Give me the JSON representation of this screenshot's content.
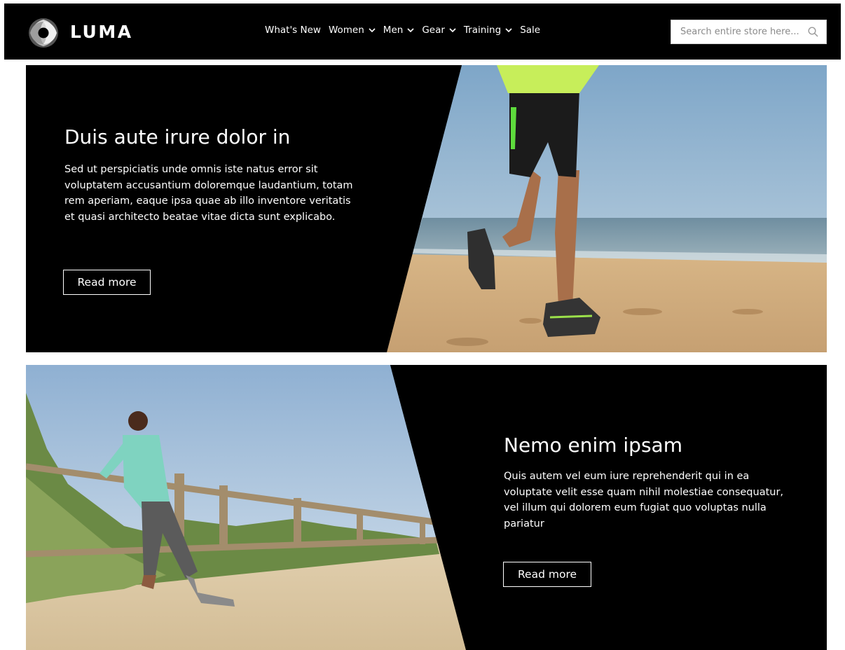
{
  "header": {
    "brand": "LUMA",
    "nav": [
      {
        "label": "What's New",
        "has_dropdown": false
      },
      {
        "label": "Women",
        "has_dropdown": true
      },
      {
        "label": "Men",
        "has_dropdown": true
      },
      {
        "label": "Gear",
        "has_dropdown": true
      },
      {
        "label": "Training",
        "has_dropdown": true
      },
      {
        "label": "Sale",
        "has_dropdown": false
      }
    ],
    "search": {
      "placeholder": "Search entire store here..."
    }
  },
  "banners": [
    {
      "title": "Duis aute irure dolor in",
      "body": "Sed ut perspiciatis unde omnis iste natus error sit voluptatem accusantium doloremque laudantium, totam rem aperiam, eaque ipsa quae ab illo inventore veritatis et quasi architecto beatae vitae dicta sunt explicabo.",
      "button": "Read more"
    },
    {
      "title": "Nemo enim ipsam",
      "body": "Quis autem vel eum iure reprehenderit qui in ea voluptate velit esse quam nihil molestiae consequatur, vel illum qui dolorem eum fugiat quo voluptas nulla pariatur",
      "button": "Read more"
    }
  ],
  "colors": {
    "header_bg": "#000000",
    "banner_panel": "#000000",
    "text": "#ffffff"
  }
}
